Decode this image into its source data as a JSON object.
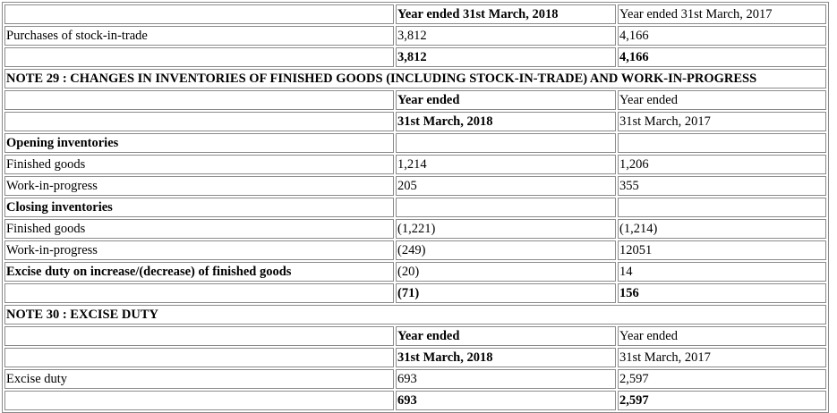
{
  "rows": [
    {
      "label": "",
      "y2018": "Year ended 31st March, 2018",
      "y2017": "Year ended 31st March, 2017"
    },
    {
      "label": "Purchases of stock-in-trade",
      "y2018": "3,812",
      "y2017": "4,166"
    },
    {
      "label": "",
      "y2018": "3,812",
      "y2017": "4,166"
    },
    {
      "note": "NOTE 29 : CHANGES IN INVENTORIES OF FINISHED GOODS (INCLUDING STOCK-IN-TRADE) AND WORK-IN-PROGRESS"
    },
    {
      "label": "",
      "y2018": "Year ended",
      "y2017": "Year ended"
    },
    {
      "label": "",
      "y2018": "31st March, 2018",
      "y2017": "31st March, 2017"
    },
    {
      "label": "Opening inventories",
      "y2018": "",
      "y2017": ""
    },
    {
      "label": "Finished goods",
      "y2018": "1,214",
      "y2017": "1,206"
    },
    {
      "label": "Work-in-progress",
      "y2018": "205",
      "y2017": "355"
    },
    {
      "label": "Closing inventories",
      "y2018": "",
      "y2017": ""
    },
    {
      "label": "Finished goods",
      "y2018": "(1,221)",
      "y2017": "(1,214)"
    },
    {
      "label": "Work-in-progress",
      "y2018": "(249)",
      "y2017": "12051"
    },
    {
      "label": "Excise duty on increase/(decrease) of finished goods",
      "y2018": "(20)",
      "y2017": "14"
    },
    {
      "label": "",
      "y2018": "(71)",
      "y2017": "156"
    },
    {
      "note": "NOTE 30 : EXCISE DUTY"
    },
    {
      "label": "",
      "y2018": "Year ended",
      "y2017": "Year ended"
    },
    {
      "label": "",
      "y2018": "31st March, 2018",
      "y2017": "31st March, 2017"
    },
    {
      "label": "Excise duty",
      "y2018": "693",
      "y2017": "2,597"
    },
    {
      "label": "",
      "y2018": "693",
      "y2017": "2,597"
    }
  ]
}
